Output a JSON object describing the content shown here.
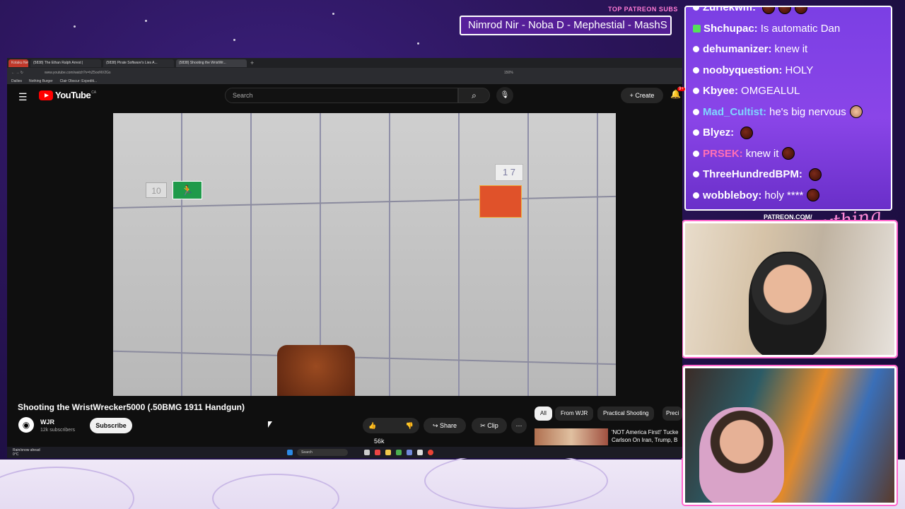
{
  "overlay": {
    "top_patreon_label": "TOP PATREON SUBS",
    "ticker_text": "Nimrod Nir - Noba D - Mephestial - MashS",
    "patreon_url_label": "PATREON.COM/",
    "signature": "Anything Else?"
  },
  "chat": {
    "messages": [
      {
        "user": "Zuriekwm:",
        "text": ""
      },
      {
        "user": "Shchupac:",
        "text": "Is automatic Dan"
      },
      {
        "user": "dehumanizer:",
        "text": "knew it"
      },
      {
        "user": "noobyquestion:",
        "text": "HOLY"
      },
      {
        "user": "Kbyee:",
        "text": "OMGEALUL"
      },
      {
        "user": "Mad_Cultist:",
        "text": "he's big nervous",
        "color": "#7fd6ff"
      },
      {
        "user": "Blyez:",
        "text": ""
      },
      {
        "user": "PRSEK:",
        "text": "knew it",
        "color": "#ff6fb5"
      },
      {
        "user": "ThreeHundredBPM:",
        "text": ""
      },
      {
        "user": "wobbleboy:",
        "text": "holy ****"
      }
    ]
  },
  "browser": {
    "tabs": [
      "Kotaku News",
      "(5838) The Ethan Ralph Arrest |",
      "(5838) Pirate Software's Lies A...",
      "(5838) Shooting the WristWr..."
    ],
    "url": "www.youtube.com/watch?v=hZ5ooNV2Gs",
    "zoom": "150%",
    "bookmarks": [
      "Dailies",
      "Nothing Burger",
      "Clair Obscur: Expediti..."
    ]
  },
  "youtube": {
    "logo_text": "YouTube",
    "region": "CA",
    "search_placeholder": "Search",
    "create_label": "Create",
    "notif_count": "9+",
    "video_title": "Shooting the WristWrecker5000 (.50BMG 1911 Handgun)",
    "channel_name": "WJR",
    "subscriber_count": "12k subscribers",
    "subscribe_label": "Subscribe",
    "likes": "56k",
    "share_label": "Share",
    "clip_label": "Clip",
    "chips": [
      "All",
      "From WJR",
      "Practical Shooting",
      "Preci"
    ],
    "rec_title_line1": "'NOT America First!' Tucke",
    "rec_title_line2": "Carlson On Iran, Trump, B"
  },
  "video_scene": {
    "sign_left": "10",
    "sign_right": "1 7"
  },
  "taskbar": {
    "weather": "Rain/snow ahead",
    "temp": "0°C",
    "search_label": "Search"
  }
}
